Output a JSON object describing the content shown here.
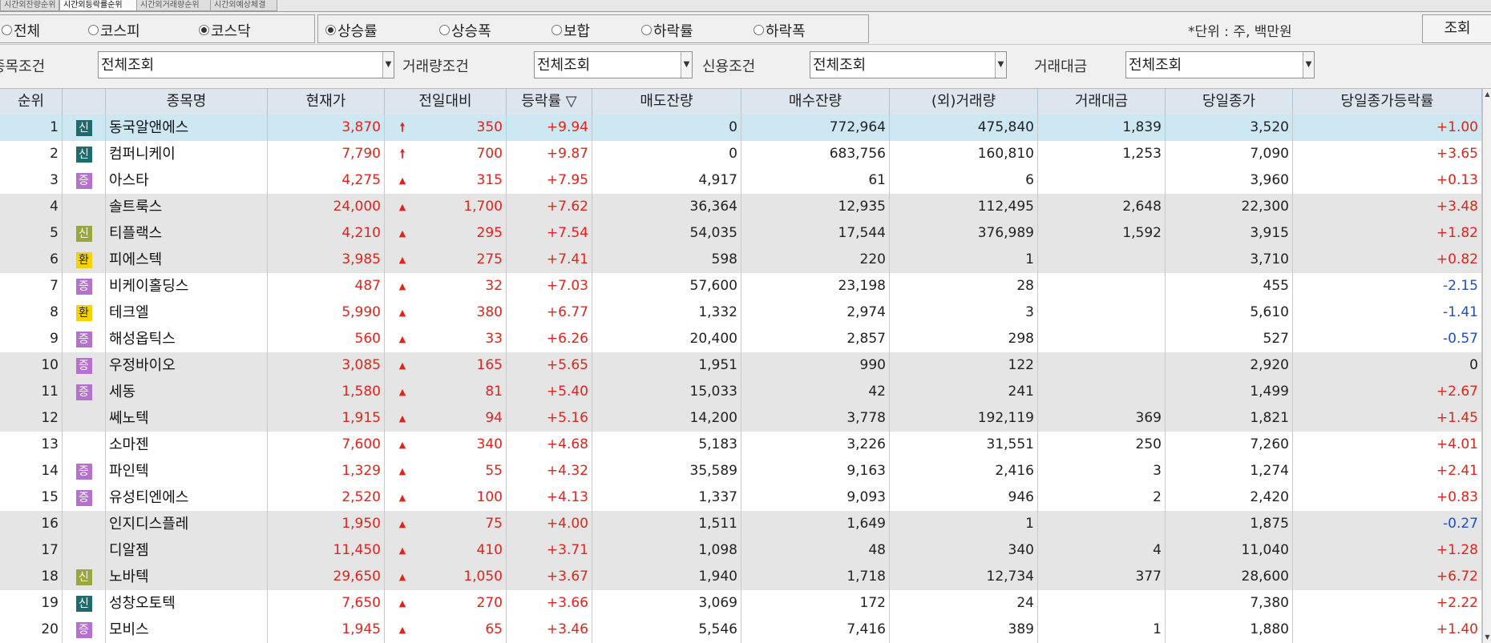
{
  "tabs": [
    "시간외잔량순위",
    "시간외등락률순위",
    "시간외거래량순위",
    "시간외예상체결"
  ],
  "market_radios": [
    {
      "label": "전체",
      "checked": false
    },
    {
      "label": "코스피",
      "checked": false
    },
    {
      "label": "코스닥",
      "checked": true
    }
  ],
  "sort_radios": [
    {
      "label": "상승률",
      "checked": true
    },
    {
      "label": "상승폭",
      "checked": false
    },
    {
      "label": "보합",
      "checked": false
    },
    {
      "label": "하락률",
      "checked": false
    },
    {
      "label": "하락폭",
      "checked": false
    }
  ],
  "unit_text": "*단위 : 주, 백만원",
  "search_button": "조회",
  "filters": {
    "stock_label": "종목조건",
    "stock_value": "전체조회",
    "volume_label": "거래량조건",
    "volume_value": "전체조회",
    "credit_label": "신용조건",
    "credit_value": "전체조회",
    "amount_label": "거래대금",
    "amount_value": "전체조회"
  },
  "columns": [
    "순위",
    "",
    "종목명",
    "현재가",
    "전일대비",
    "등락률 ▽",
    "매도잔량",
    "매수잔량",
    "(외)거래량",
    "거래대금",
    "당일종가",
    "당일종가등락률"
  ],
  "rows": [
    {
      "rank": "1",
      "badge": "신",
      "badge_type": "sin1",
      "name": "동국알앤에스",
      "price": "3,870",
      "arrow": "up-limit",
      "change": "350",
      "rate": "+9.94",
      "ask": "0",
      "bid": "772,964",
      "volume": "475,840",
      "amount": "1,839",
      "close": "3,520",
      "close_rate": "+1.00",
      "close_dir": "up"
    },
    {
      "rank": "2",
      "badge": "신",
      "badge_type": "sin1",
      "name": "컴퍼니케이",
      "price": "7,790",
      "arrow": "up-limit",
      "change": "700",
      "rate": "+9.87",
      "ask": "0",
      "bid": "683,756",
      "volume": "160,810",
      "amount": "1,253",
      "close": "7,090",
      "close_rate": "+3.65",
      "close_dir": "up"
    },
    {
      "rank": "3",
      "badge": "증",
      "badge_type": "jeung",
      "name": "아스타",
      "price": "4,275",
      "arrow": "up",
      "change": "315",
      "rate": "+7.95",
      "ask": "4,917",
      "bid": "61",
      "volume": "6",
      "amount": "",
      "close": "3,960",
      "close_rate": "+0.13",
      "close_dir": "up"
    },
    {
      "rank": "4",
      "badge": "",
      "badge_type": "",
      "name": "솔트룩스",
      "price": "24,000",
      "arrow": "up",
      "change": "1,700",
      "rate": "+7.62",
      "ask": "36,364",
      "bid": "12,935",
      "volume": "112,495",
      "amount": "2,648",
      "close": "22,300",
      "close_rate": "+3.48",
      "close_dir": "up"
    },
    {
      "rank": "5",
      "badge": "신",
      "badge_type": "sin2",
      "name": "티플랙스",
      "price": "4,210",
      "arrow": "up",
      "change": "295",
      "rate": "+7.54",
      "ask": "54,035",
      "bid": "17,544",
      "volume": "376,989",
      "amount": "1,592",
      "close": "3,915",
      "close_rate": "+1.82",
      "close_dir": "up"
    },
    {
      "rank": "6",
      "badge": "환",
      "badge_type": "hwan",
      "name": "피에스텍",
      "price": "3,985",
      "arrow": "up",
      "change": "275",
      "rate": "+7.41",
      "ask": "598",
      "bid": "220",
      "volume": "1",
      "amount": "",
      "close": "3,710",
      "close_rate": "+0.82",
      "close_dir": "up"
    },
    {
      "rank": "7",
      "badge": "증",
      "badge_type": "jeung",
      "name": "비케이홀딩스",
      "price": "487",
      "arrow": "up",
      "change": "32",
      "rate": "+7.03",
      "ask": "57,600",
      "bid": "23,198",
      "volume": "28",
      "amount": "",
      "close": "455",
      "close_rate": "-2.15",
      "close_dir": "down"
    },
    {
      "rank": "8",
      "badge": "환",
      "badge_type": "hwan",
      "name": "테크엘",
      "price": "5,990",
      "arrow": "up",
      "change": "380",
      "rate": "+6.77",
      "ask": "1,332",
      "bid": "2,974",
      "volume": "3",
      "amount": "",
      "close": "5,610",
      "close_rate": "-1.41",
      "close_dir": "down"
    },
    {
      "rank": "9",
      "badge": "증",
      "badge_type": "jeung",
      "name": "해성옵틱스",
      "price": "560",
      "arrow": "up",
      "change": "33",
      "rate": "+6.26",
      "ask": "20,400",
      "bid": "2,857",
      "volume": "298",
      "amount": "",
      "close": "527",
      "close_rate": "-0.57",
      "close_dir": "down"
    },
    {
      "rank": "10",
      "badge": "증",
      "badge_type": "jeung",
      "name": "우정바이오",
      "price": "3,085",
      "arrow": "up",
      "change": "165",
      "rate": "+5.65",
      "ask": "1,951",
      "bid": "990",
      "volume": "122",
      "amount": "",
      "close": "2,920",
      "close_rate": "0",
      "close_dir": "flat"
    },
    {
      "rank": "11",
      "badge": "증",
      "badge_type": "jeung",
      "name": "세동",
      "price": "1,580",
      "arrow": "up",
      "change": "81",
      "rate": "+5.40",
      "ask": "15,033",
      "bid": "42",
      "volume": "241",
      "amount": "",
      "close": "1,499",
      "close_rate": "+2.67",
      "close_dir": "up"
    },
    {
      "rank": "12",
      "badge": "",
      "badge_type": "",
      "name": "쎄노텍",
      "price": "1,915",
      "arrow": "up",
      "change": "94",
      "rate": "+5.16",
      "ask": "14,200",
      "bid": "3,778",
      "volume": "192,119",
      "amount": "369",
      "close": "1,821",
      "close_rate": "+1.45",
      "close_dir": "up"
    },
    {
      "rank": "13",
      "badge": "",
      "badge_type": "",
      "name": "소마젠",
      "price": "7,600",
      "arrow": "up",
      "change": "340",
      "rate": "+4.68",
      "ask": "5,183",
      "bid": "3,226",
      "volume": "31,551",
      "amount": "250",
      "close": "7,260",
      "close_rate": "+4.01",
      "close_dir": "up"
    },
    {
      "rank": "14",
      "badge": "증",
      "badge_type": "jeung",
      "name": "파인텍",
      "price": "1,329",
      "arrow": "up",
      "change": "55",
      "rate": "+4.32",
      "ask": "35,589",
      "bid": "9,163",
      "volume": "2,416",
      "amount": "3",
      "close": "1,274",
      "close_rate": "+2.41",
      "close_dir": "up"
    },
    {
      "rank": "15",
      "badge": "증",
      "badge_type": "jeung",
      "name": "유성티엔에스",
      "price": "2,520",
      "arrow": "up",
      "change": "100",
      "rate": "+4.13",
      "ask": "1,337",
      "bid": "9,093",
      "volume": "946",
      "amount": "2",
      "close": "2,420",
      "close_rate": "+0.83",
      "close_dir": "up"
    },
    {
      "rank": "16",
      "badge": "",
      "badge_type": "",
      "name": "인지디스플레",
      "price": "1,950",
      "arrow": "up",
      "change": "75",
      "rate": "+4.00",
      "ask": "1,511",
      "bid": "1,649",
      "volume": "1",
      "amount": "",
      "close": "1,875",
      "close_rate": "-0.27",
      "close_dir": "down"
    },
    {
      "rank": "17",
      "badge": "",
      "badge_type": "",
      "name": "디알젬",
      "price": "11,450",
      "arrow": "up",
      "change": "410",
      "rate": "+3.71",
      "ask": "1,098",
      "bid": "48",
      "volume": "340",
      "amount": "4",
      "close": "11,040",
      "close_rate": "+1.28",
      "close_dir": "up"
    },
    {
      "rank": "18",
      "badge": "신",
      "badge_type": "sin2",
      "name": "노바텍",
      "price": "29,650",
      "arrow": "up",
      "change": "1,050",
      "rate": "+3.67",
      "ask": "1,940",
      "bid": "1,718",
      "volume": "12,734",
      "amount": "377",
      "close": "28,600",
      "close_rate": "+6.72",
      "close_dir": "up"
    },
    {
      "rank": "19",
      "badge": "신",
      "badge_type": "sin1",
      "name": "성창오토텍",
      "price": "7,650",
      "arrow": "up",
      "change": "270",
      "rate": "+3.66",
      "ask": "3,069",
      "bid": "172",
      "volume": "24",
      "amount": "",
      "close": "7,380",
      "close_rate": "+2.22",
      "close_dir": "up"
    },
    {
      "rank": "20",
      "badge": "증",
      "badge_type": "jeung",
      "name": "모비스",
      "price": "1,945",
      "arrow": "up",
      "change": "65",
      "rate": "+3.46",
      "ask": "5,546",
      "bid": "7,416",
      "volume": "389",
      "amount": "1",
      "close": "1,880",
      "close_rate": "+1.40",
      "close_dir": "up"
    }
  ],
  "colors": {
    "up": "#e0241c",
    "down": "#1d4fc0",
    "selected_row": "#cde8f3",
    "band_gray": "#e5e5e5",
    "header_bg": "#dde5ee"
  }
}
